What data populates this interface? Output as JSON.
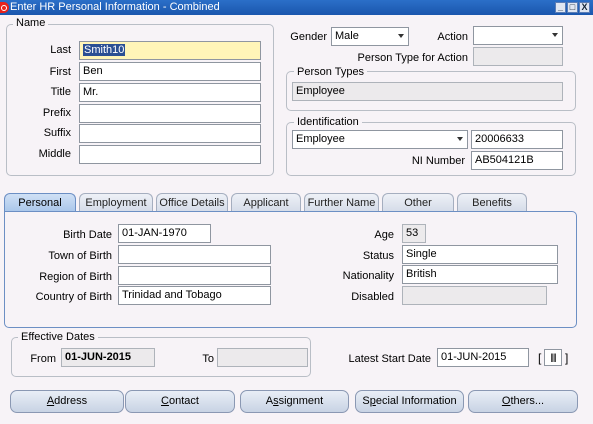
{
  "window": {
    "title": "Enter HR Personal Information - Combined",
    "minimize": "_",
    "maximize": "□",
    "close": "X"
  },
  "name_group": {
    "title": "Name",
    "last_label": "Last",
    "last_value": "Smith10",
    "first_label": "First",
    "first_value": "Ben",
    "title_label": "Title",
    "title_value": "Mr.",
    "prefix_label": "Prefix",
    "prefix_value": "",
    "suffix_label": "Suffix",
    "suffix_value": "",
    "middle_label": "Middle",
    "middle_value": ""
  },
  "gender": {
    "label": "Gender",
    "value": "Male"
  },
  "action": {
    "label": "Action",
    "value": ""
  },
  "person_type_for_action": {
    "label": "Person Type for Action",
    "value": ""
  },
  "person_types": {
    "title": "Person Types",
    "value": "Employee"
  },
  "identification": {
    "title": "Identification",
    "type_value": "Employee",
    "number_value": "20006633",
    "ni_label": "NI Number",
    "ni_value": "AB504121B"
  },
  "tabs": [
    {
      "label": "Personal",
      "active": true
    },
    {
      "label": "Employment",
      "active": false
    },
    {
      "label": "Office Details",
      "active": false
    },
    {
      "label": "Applicant",
      "active": false
    },
    {
      "label": "Further Name",
      "active": false
    },
    {
      "label": "Other",
      "active": false
    },
    {
      "label": "Benefits",
      "active": false
    }
  ],
  "personal": {
    "birth_date_label": "Birth Date",
    "birth_date_value": "01-JAN-1970",
    "town_of_birth_label": "Town of Birth",
    "town_of_birth_value": "",
    "region_of_birth_label": "Region of Birth",
    "region_of_birth_value": "",
    "country_of_birth_label": "Country of Birth",
    "country_of_birth_value": "Trinidad and Tobago",
    "age_label": "Age",
    "age_value": "53",
    "status_label": "Status",
    "status_value": "Single",
    "nationality_label": "Nationality",
    "nationality_value": "British",
    "disabled_label": "Disabled",
    "disabled_value": ""
  },
  "effective_dates": {
    "title": "Effective Dates",
    "from_label": "From",
    "from_value": "01-JUN-2015",
    "to_label": "To",
    "to_value": ""
  },
  "latest_start_date": {
    "label": "Latest Start Date",
    "value": "01-JUN-2015"
  },
  "flex_field": {
    "open": "[",
    "glyph": "||||",
    "close": "]"
  },
  "buttons": {
    "address": {
      "accel": "A",
      "rest": "ddress"
    },
    "contact": {
      "accel": "C",
      "rest": "ontact"
    },
    "assignment": {
      "pre": "A",
      "accel": "s",
      "rest": "signment"
    },
    "special": {
      "pre": "S",
      "accel": "p",
      "rest": "ecial Information"
    },
    "others": {
      "accel": "O",
      "rest": "thers..."
    }
  },
  "colors": {
    "titlebar": "#1a56ad",
    "required_field": "#fff5b8",
    "active_tab": "#a9c6ea",
    "selection": "#2a4f93"
  }
}
